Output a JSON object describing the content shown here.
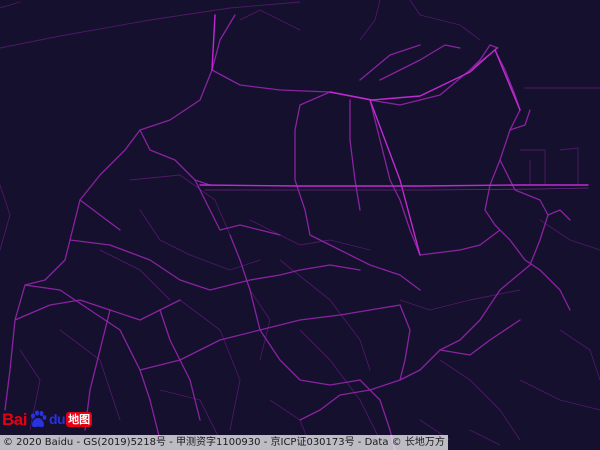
{
  "map": {
    "background_color": "#14102e",
    "road_color_dim": "#6a1f7d",
    "road_color_bright": "#c02ad0"
  },
  "logo": {
    "wordmark": "Bai",
    "wordmark_suffix": "du",
    "icon": "baidu-paw-icon",
    "cn_text": "地图",
    "brand_color": "#e60012"
  },
  "copyright": {
    "text": "© 2020 Baidu - GS(2019)5218号 - 甲测资字1100930 - 京ICP证030173号 - Data © 长地万方"
  }
}
